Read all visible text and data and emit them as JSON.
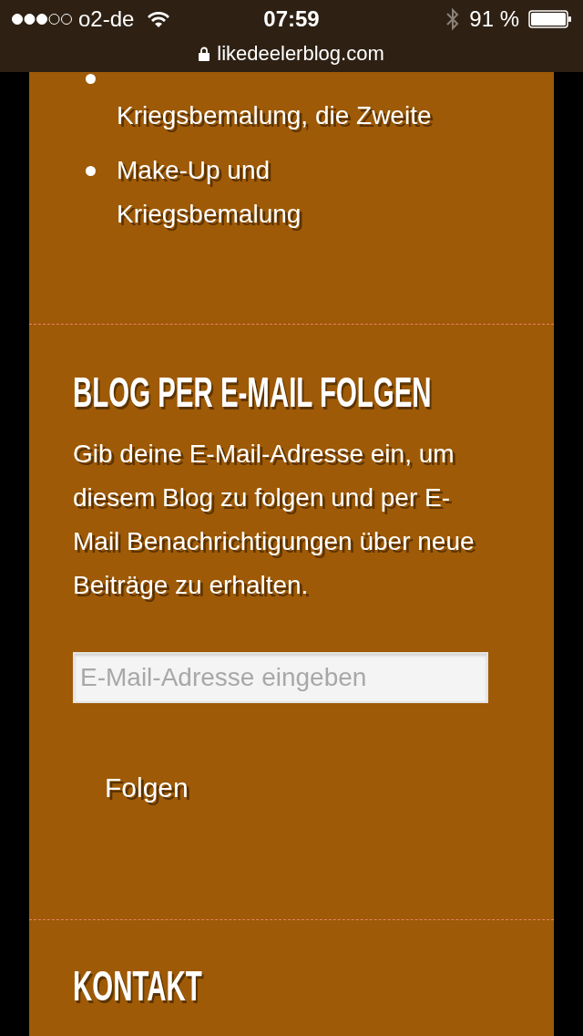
{
  "status_bar": {
    "carrier": "o2-de",
    "time": "07:59",
    "battery": "91 %"
  },
  "address_bar": {
    "url": "likedeelerblog.com"
  },
  "recent_posts": [
    "Kriegsbemalung, die Zweite",
    "Make-Up und Kriegsbemalung"
  ],
  "follow_widget": {
    "title": "BLOG PER E-MAIL FOLGEN",
    "description": "Gib deine E-Mail-Adresse ein, um diesem Blog zu folgen und per E-Mail Benachrichtigungen über neue Beiträge zu erhalten.",
    "email_field": {
      "placeholder": "E-Mail-Adresse eingeben"
    },
    "button": "Folgen"
  },
  "contact_widget": {
    "title": "KONTAKT"
  }
}
